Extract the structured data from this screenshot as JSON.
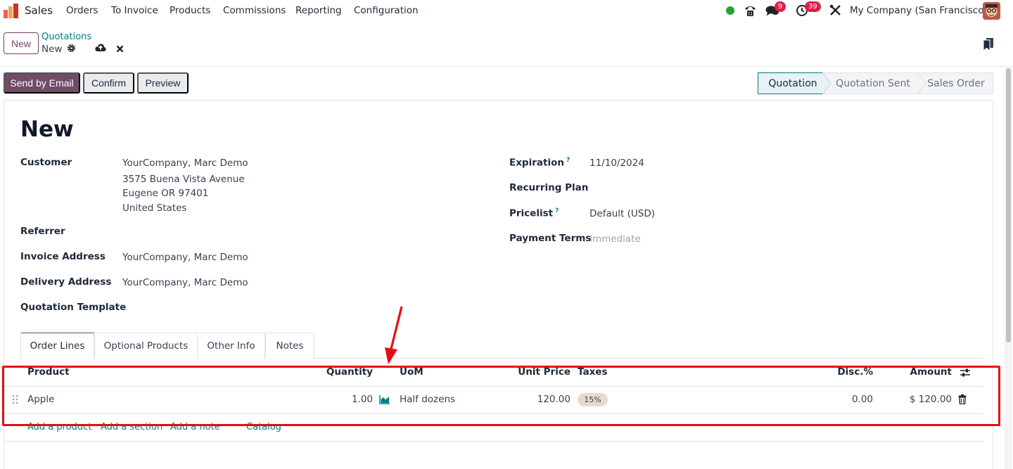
{
  "navbar": {
    "app_name": "Sales",
    "menus": [
      "Orders",
      "To Invoice",
      "Products",
      "Commissions",
      "Reporting",
      "Configuration"
    ],
    "messages_count": "9",
    "activities_count": "39",
    "company": "My Company (San Francisco)"
  },
  "control_panel": {
    "new_label": "New",
    "breadcrumb_parent": "Quotations",
    "breadcrumb_current": "New"
  },
  "actions": {
    "send_email": "Send by Email",
    "confirm": "Confirm",
    "preview": "Preview"
  },
  "status_bar": {
    "stages": [
      "Quotation",
      "Quotation Sent",
      "Sales Order"
    ],
    "active": "Quotation"
  },
  "form": {
    "title": "New",
    "customer_label": "Customer",
    "customer_lines": [
      "YourCompany, Marc Demo",
      "3575 Buena Vista Avenue",
      "Eugene OR 97401",
      "United States"
    ],
    "referrer_label": "Referrer",
    "invoice_address_label": "Invoice Address",
    "invoice_address": "YourCompany, Marc Demo",
    "delivery_address_label": "Delivery Address",
    "delivery_address": "YourCompany, Marc Demo",
    "quotation_template_label": "Quotation Template",
    "expiration_label": "Expiration",
    "expiration": "11/10/2024",
    "recurring_plan_label": "Recurring Plan",
    "pricelist_label": "Pricelist",
    "pricelist": "Default (USD)",
    "payment_terms_label": "Payment Terms",
    "payment_terms_placeholder": "Immediate",
    "help_mark": "?"
  },
  "tabs": [
    "Order Lines",
    "Optional Products",
    "Other Info",
    "Notes"
  ],
  "order_lines": {
    "columns": {
      "product": "Product",
      "quantity": "Quantity",
      "uom": "UoM",
      "unit_price": "Unit Price",
      "taxes": "Taxes",
      "discount": "Disc.%",
      "amount": "Amount"
    },
    "rows": [
      {
        "product": "Apple",
        "quantity": "1.00",
        "uom": "Half dozens",
        "unit_price": "120.00",
        "taxes": "15%",
        "discount": "0.00",
        "amount": "$ 120.00"
      }
    ],
    "add_product": "Add a product",
    "add_section": "Add a section",
    "add_note": "Add a note",
    "catalog": "Catalog"
  },
  "colors": {
    "brand": "#714b67",
    "link": "#017e84",
    "highlight": "#e60d12"
  }
}
